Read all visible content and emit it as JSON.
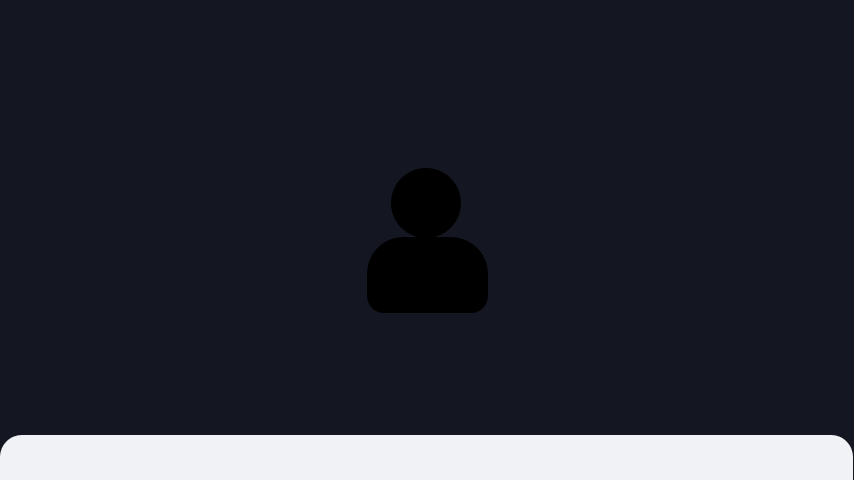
{
  "avatar": {
    "icon": "user-silhouette-icon"
  },
  "bottom_bar": {
    "text": ""
  },
  "colors": {
    "background": "#141722",
    "avatar_fill": "#000000",
    "bottom_bar": "#f1f2f5"
  }
}
